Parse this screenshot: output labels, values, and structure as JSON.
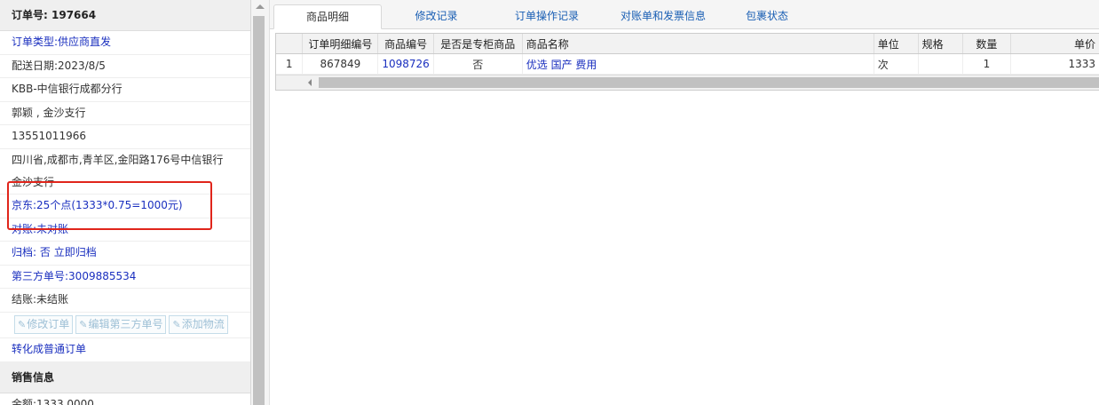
{
  "left": {
    "order_label": "订单号:",
    "order_no": "197664",
    "order_type": "订单类型:供应商直发",
    "delivery_date": "配送日期:2023/8/5",
    "customer": "KBB-中信银行成都分行",
    "contact": "郭颖 , 金沙支行",
    "phone": "13551011966",
    "address": "四川省,成都市,青羊区,金阳路176号中信银行金沙支行",
    "jd": "京东:25个点(1333*0.75=1000元)",
    "reconcile": "对账:未对账",
    "archive_label": "归档:",
    "archive_value": "否",
    "archive_link": "立即归档",
    "third_party": "第三方单号:3009885534",
    "settlement": "结账:未结账",
    "buttons": [
      "修改订单",
      "编辑第三方单号",
      "添加物流"
    ],
    "convert": "转化成普通订单",
    "sales_header": "销售信息",
    "amount": "金额:1333.0000"
  },
  "tabs": [
    "商品明细",
    "修改记录",
    "订单操作记录",
    "对账单和发票信息",
    "包裹状态"
  ],
  "table": {
    "headers": [
      "",
      "订单明细编号",
      "商品编号",
      "是否是专柜商品",
      "商品名称",
      "单位",
      "规格",
      "数量",
      "单价"
    ],
    "rows": [
      [
        "1",
        "867849",
        "1098726",
        "否",
        "优选 国产 费用",
        "次",
        "",
        "1",
        "1333"
      ]
    ]
  },
  "colors": {
    "link": "#1a2fbf",
    "highlight_box": "#e0251b"
  }
}
